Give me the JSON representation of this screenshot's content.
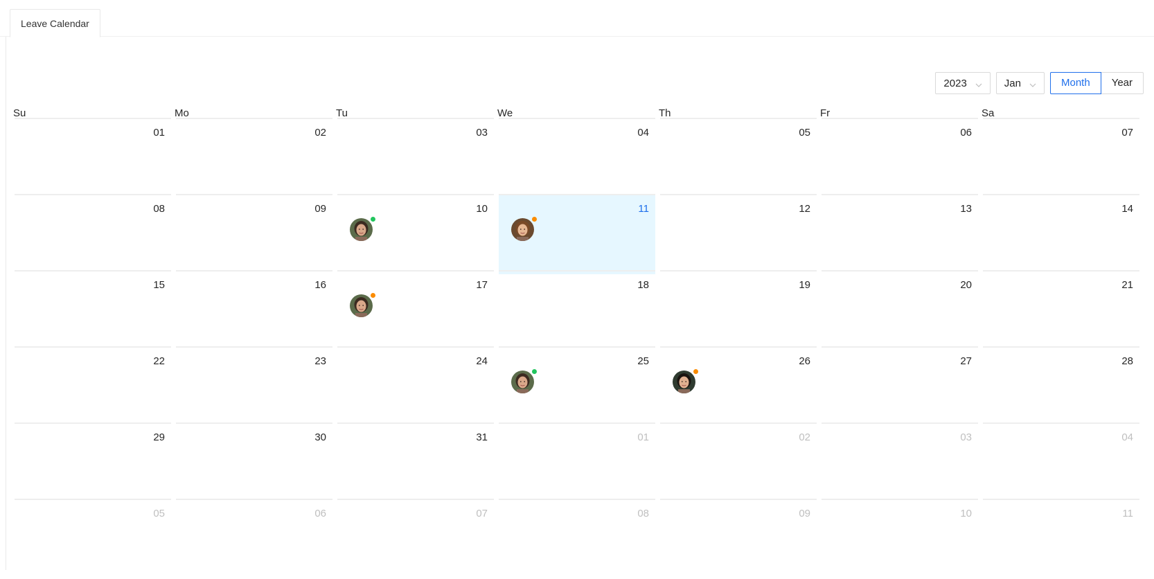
{
  "tab": {
    "label": "Leave Calendar"
  },
  "controls": {
    "year": "2023",
    "month": "Jan",
    "mode_month": "Month",
    "mode_year": "Year",
    "active_mode": "Month"
  },
  "weekdays": [
    "Su",
    "Mo",
    "Tu",
    "We",
    "Th",
    "Fr",
    "Sa"
  ],
  "colors": {
    "accent": "#1f6feb",
    "today_bg": "#e6f7ff",
    "status_green": "#22c55e",
    "status_orange": "#fb8c00"
  },
  "weeks": [
    [
      {
        "day": "01",
        "other": false
      },
      {
        "day": "02",
        "other": false
      },
      {
        "day": "03",
        "other": false
      },
      {
        "day": "04",
        "other": false
      },
      {
        "day": "05",
        "other": false
      },
      {
        "day": "06",
        "other": false
      },
      {
        "day": "07",
        "other": false
      }
    ],
    [
      {
        "day": "08",
        "other": false
      },
      {
        "day": "09",
        "other": false
      },
      {
        "day": "10",
        "other": false,
        "avatar": {
          "status": "green",
          "person": "woman-1"
        }
      },
      {
        "day": "11",
        "other": false,
        "today": true,
        "avatar": {
          "status": "orange",
          "person": "man-1"
        }
      },
      {
        "day": "12",
        "other": false
      },
      {
        "day": "13",
        "other": false
      },
      {
        "day": "14",
        "other": false
      }
    ],
    [
      {
        "day": "15",
        "other": false
      },
      {
        "day": "16",
        "other": false
      },
      {
        "day": "17",
        "other": false,
        "avatar": {
          "status": "orange",
          "person": "woman-1"
        }
      },
      {
        "day": "18",
        "other": false
      },
      {
        "day": "19",
        "other": false
      },
      {
        "day": "20",
        "other": false
      },
      {
        "day": "21",
        "other": false
      }
    ],
    [
      {
        "day": "22",
        "other": false
      },
      {
        "day": "23",
        "other": false
      },
      {
        "day": "24",
        "other": false
      },
      {
        "day": "25",
        "other": false,
        "avatar": {
          "status": "green",
          "person": "woman-1"
        }
      },
      {
        "day": "26",
        "other": false,
        "avatar": {
          "status": "orange",
          "person": "woman-2"
        }
      },
      {
        "day": "27",
        "other": false
      },
      {
        "day": "28",
        "other": false
      }
    ],
    [
      {
        "day": "29",
        "other": false
      },
      {
        "day": "30",
        "other": false
      },
      {
        "day": "31",
        "other": false
      },
      {
        "day": "01",
        "other": true
      },
      {
        "day": "02",
        "other": true
      },
      {
        "day": "03",
        "other": true
      },
      {
        "day": "04",
        "other": true
      }
    ],
    [
      {
        "day": "05",
        "other": true
      },
      {
        "day": "06",
        "other": true
      },
      {
        "day": "07",
        "other": true
      },
      {
        "day": "08",
        "other": true
      },
      {
        "day": "09",
        "other": true
      },
      {
        "day": "10",
        "other": true
      },
      {
        "day": "11",
        "other": true
      }
    ]
  ]
}
